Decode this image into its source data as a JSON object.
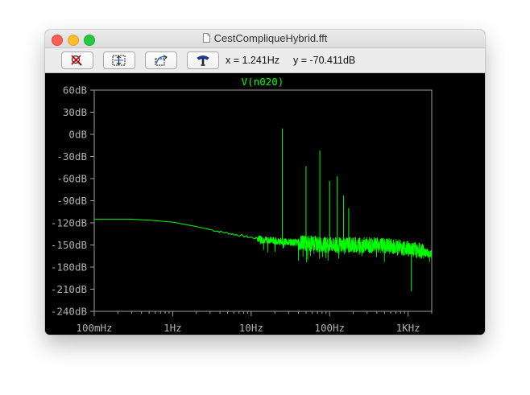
{
  "window": {
    "title": "CestCompliqueHybrid.fft"
  },
  "toolbar": {
    "buttons": [
      {
        "icon": "zoom-cancel-icon"
      },
      {
        "icon": "zoom-fit-icon"
      },
      {
        "icon": "zoom-area-icon"
      },
      {
        "icon": "probe-icon"
      }
    ],
    "x_readout": "x = 1.241Hz",
    "y_readout": "y = -70.411dB"
  },
  "colors": {
    "trace": "#00ff00",
    "axes": "#9e9e9e",
    "tick_label": "#b0b0b0",
    "background": "#000000"
  },
  "chart_data": {
    "type": "line",
    "title": "V(n020)",
    "xscale": "log",
    "xlim": [
      0.1,
      2000
    ],
    "ylim": [
      -240,
      60
    ],
    "xticks": [
      {
        "value": 0.1,
        "label": "100mHz"
      },
      {
        "value": 1,
        "label": "1Hz"
      },
      {
        "value": 10,
        "label": "10Hz"
      },
      {
        "value": 100,
        "label": "100Hz"
      },
      {
        "value": 1000,
        "label": "1KHz"
      }
    ],
    "yticks": [
      {
        "value": 60,
        "label": "60dB"
      },
      {
        "value": 30,
        "label": "30dB"
      },
      {
        "value": 0,
        "label": "0dB"
      },
      {
        "value": -30,
        "label": "-30dB"
      },
      {
        "value": -60,
        "label": "-60dB"
      },
      {
        "value": -90,
        "label": "-90dB"
      },
      {
        "value": -120,
        "label": "-120dB"
      },
      {
        "value": -150,
        "label": "-150dB"
      },
      {
        "value": -180,
        "label": "-180dB"
      },
      {
        "value": -210,
        "label": "-210dB"
      },
      {
        "value": -240,
        "label": "-240dB"
      }
    ],
    "baseline": [
      [
        0.1,
        -115
      ],
      [
        0.3,
        -115
      ],
      [
        0.6,
        -117
      ],
      [
        1,
        -119
      ],
      [
        2,
        -125
      ],
      [
        4,
        -132
      ],
      [
        8,
        -138
      ],
      [
        15,
        -143
      ],
      [
        30,
        -146
      ],
      [
        60,
        -148
      ],
      [
        100,
        -150
      ],
      [
        300,
        -150
      ],
      [
        700,
        -152
      ],
      [
        1000,
        -155
      ],
      [
        1500,
        -158
      ],
      [
        2000,
        -163
      ]
    ],
    "harmonics": [
      {
        "x": 25,
        "y": 8
      },
      {
        "x": 50,
        "y": -43
      },
      {
        "x": 75,
        "y": -22
      },
      {
        "x": 100,
        "y": -63
      },
      {
        "x": 125,
        "y": -57
      },
      {
        "x": 150,
        "y": -83
      },
      {
        "x": 175,
        "y": -100
      }
    ],
    "noise_floor_min": -213
  }
}
